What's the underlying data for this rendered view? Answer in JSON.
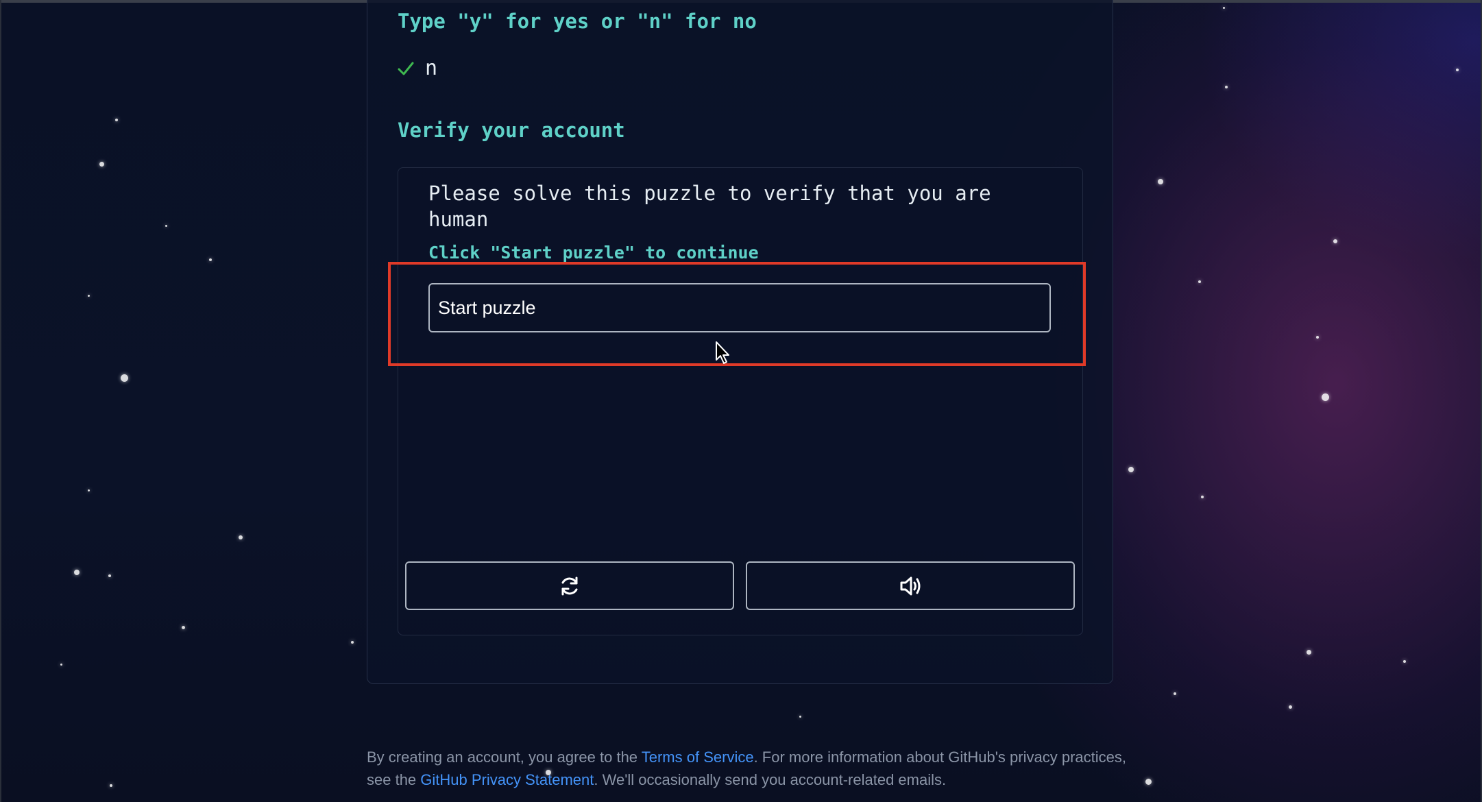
{
  "prompt": {
    "title": "Type \"y\" for yes or \"n\" for no",
    "answer": "n",
    "answer_status_icon": "check-icon",
    "answer_status_color": "#3fb950"
  },
  "verify": {
    "title": "Verify your account",
    "description": "Please solve this puzzle to verify that you are human",
    "hint": "Click \"Start puzzle\" to continue",
    "start_button_label": "Start puzzle",
    "refresh_icon": "refresh-icon",
    "audio_icon": "audio-icon"
  },
  "footer": {
    "text_1": "By creating an account, you agree to the ",
    "terms_link": "Terms of Service",
    "text_2": ". For more information about GitHub's privacy practices, see the ",
    "privacy_link": "GitHub Privacy Statement",
    "text_3": ". We'll occasionally send you account-related emails."
  },
  "colors": {
    "accent": "#5fd1c8",
    "link": "#4493f8",
    "highlight": "#e03a28",
    "background": "#0a1126"
  }
}
